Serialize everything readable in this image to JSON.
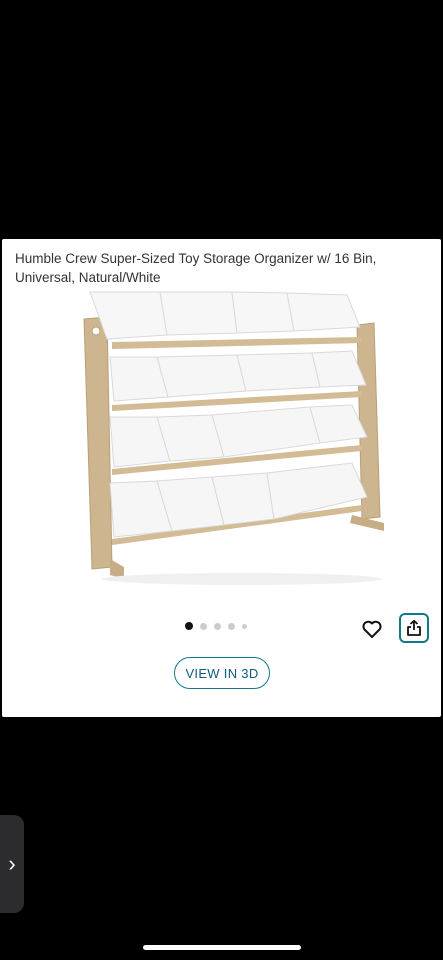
{
  "product": {
    "title": "Humble Crew Super-Sized Toy Storage Organizer w/ 16 Bin, Universal, Natural/White"
  },
  "gallery": {
    "image_count": 5,
    "active_index": 0
  },
  "actions": {
    "view_3d_label": "VIEW IN 3D",
    "favorite_icon": "heart-icon",
    "share_icon": "share-icon"
  },
  "edge_tab": {
    "glyph": "›"
  },
  "colors": {
    "accent": "#0f7a86",
    "background": "#000000"
  }
}
